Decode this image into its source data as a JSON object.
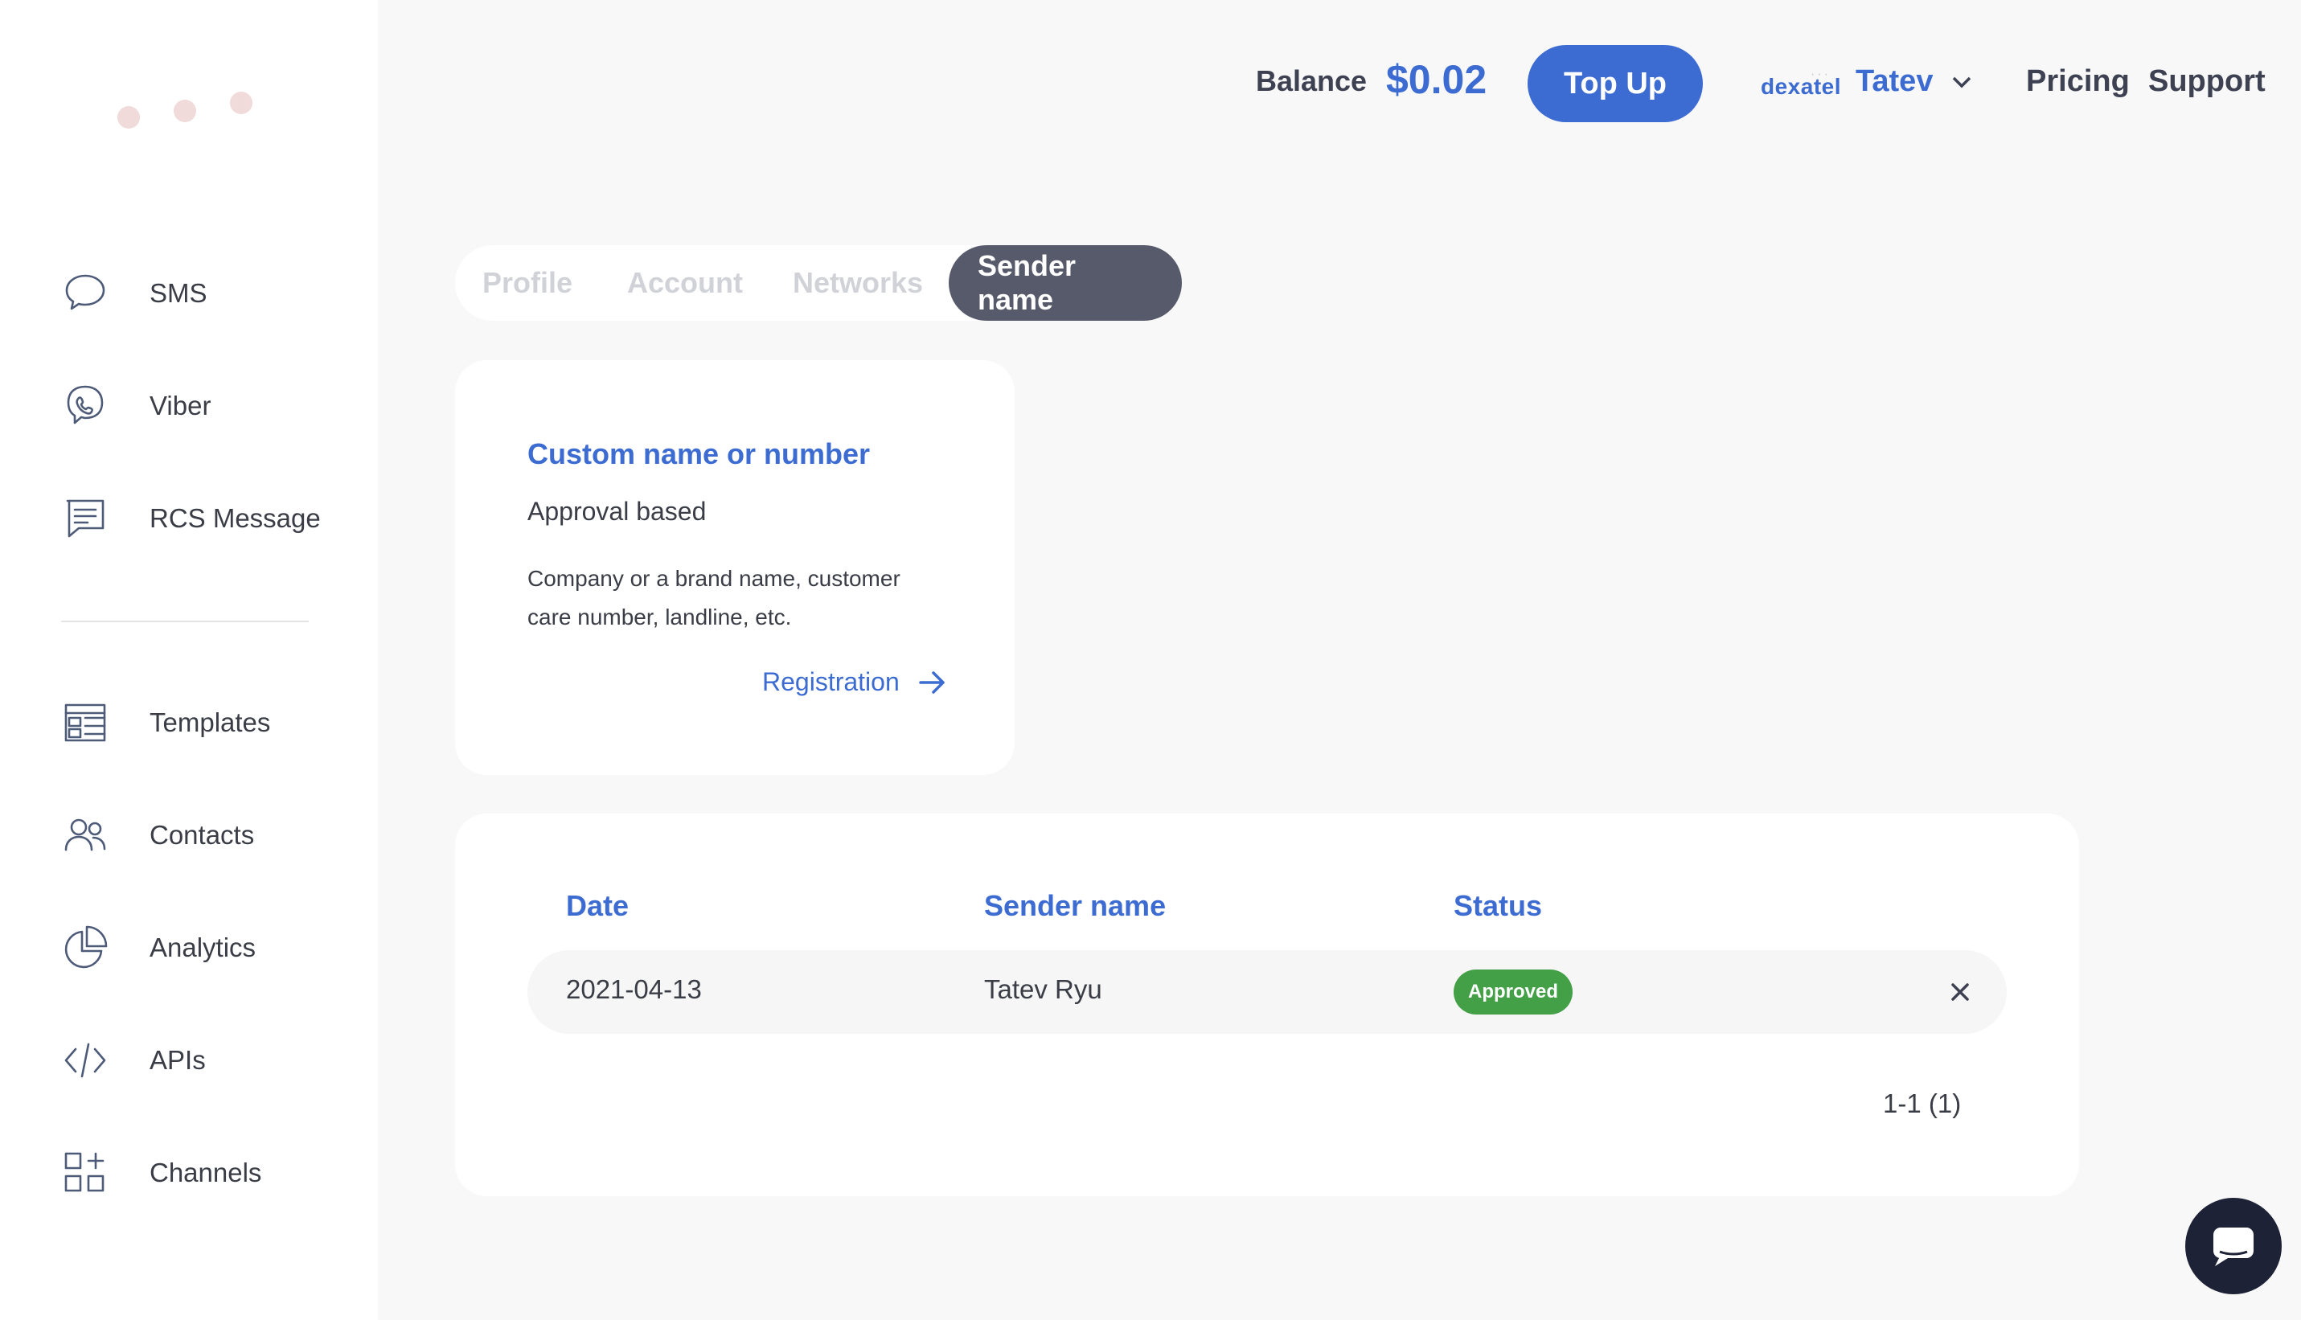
{
  "sidebar": {
    "items": [
      {
        "label": "SMS",
        "icon": "chat-bubble-icon"
      },
      {
        "label": "Viber",
        "icon": "viber-icon"
      },
      {
        "label": "RCS Message",
        "icon": "message-lines-icon"
      },
      {
        "label": "Templates",
        "icon": "templates-icon"
      },
      {
        "label": "Contacts",
        "icon": "contacts-icon"
      },
      {
        "label": "Analytics",
        "icon": "pie-chart-icon"
      },
      {
        "label": "APIs",
        "icon": "code-icon"
      },
      {
        "label": "Channels",
        "icon": "channels-grid-icon"
      }
    ]
  },
  "header": {
    "balance_label": "Balance",
    "balance_value": "$0.02",
    "topup_label": "Top Up",
    "brand": "dexatel",
    "user_name": "Tatev",
    "pricing_label": "Pricing",
    "support_label": "Support"
  },
  "tabs": [
    {
      "label": "Profile",
      "active": false
    },
    {
      "label": "Account",
      "active": false
    },
    {
      "label": "Networks",
      "active": false
    },
    {
      "label": "Sender name",
      "active": true
    }
  ],
  "card": {
    "title": "Custom name or number",
    "subtitle": "Approval based",
    "description": "Company or a brand name, customer care number, landline, etc.",
    "link_label": "Registration"
  },
  "table": {
    "columns": [
      "Date",
      "Sender name",
      "Status"
    ],
    "rows": [
      {
        "date": "2021-04-13",
        "sender_name": "Tatev Ryu",
        "status": "Approved"
      }
    ],
    "pagination": "1-1 (1)"
  },
  "colors": {
    "accent": "#3c6bd1",
    "status_approved": "#43a047",
    "active_tab": "#575a6a",
    "chat_button": "#1d2236"
  }
}
